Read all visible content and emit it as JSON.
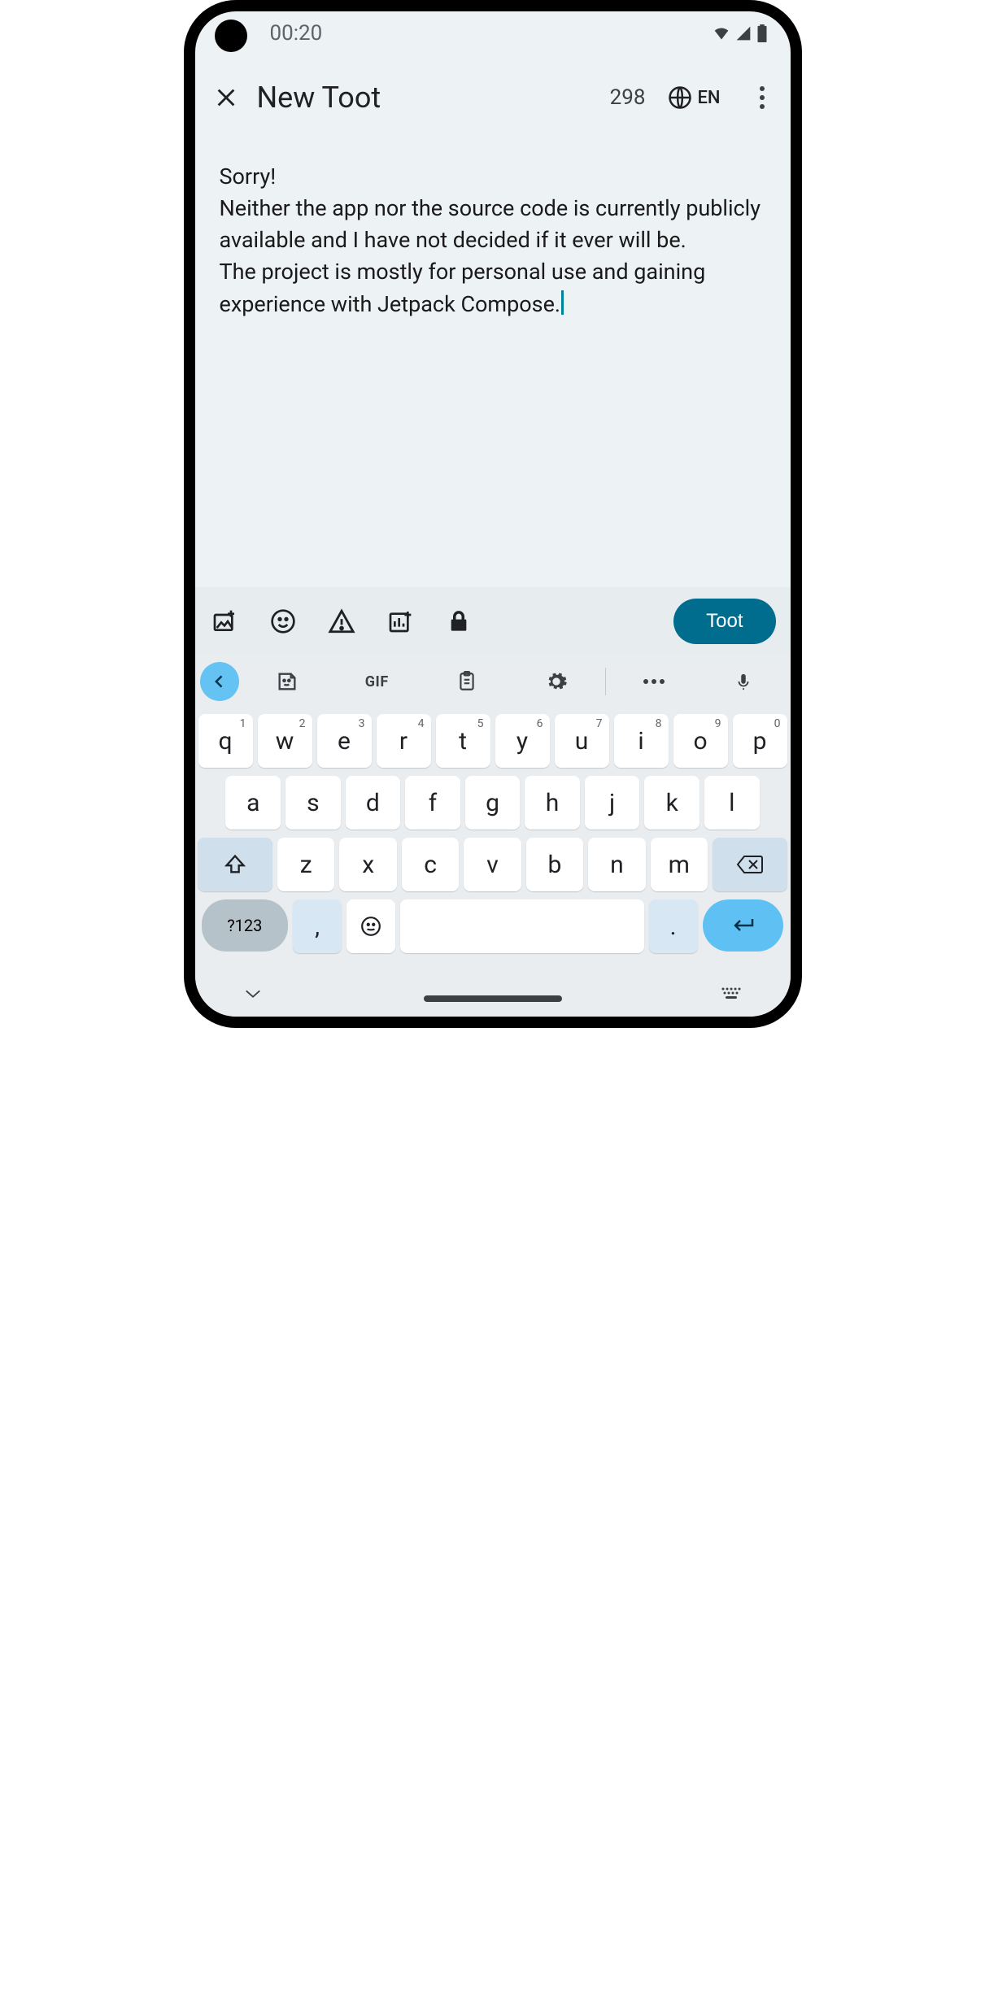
{
  "status": {
    "time": "00:20"
  },
  "appbar": {
    "title": "New Toot",
    "char_count": "298",
    "language": "EN"
  },
  "compose": {
    "text": "Sorry!\nNeither the app nor the source code is currently publicly available and I have not decided if it ever will be.\nThe project is mostly for personal use and gaining experience with Jetpack Compose."
  },
  "toolbar": {
    "submit_label": "Toot"
  },
  "keyboard": {
    "gif_label": "GIF",
    "row1": [
      {
        "k": "q",
        "s": "1"
      },
      {
        "k": "w",
        "s": "2"
      },
      {
        "k": "e",
        "s": "3"
      },
      {
        "k": "r",
        "s": "4"
      },
      {
        "k": "t",
        "s": "5"
      },
      {
        "k": "y",
        "s": "6"
      },
      {
        "k": "u",
        "s": "7"
      },
      {
        "k": "i",
        "s": "8"
      },
      {
        "k": "o",
        "s": "9"
      },
      {
        "k": "p",
        "s": "0"
      }
    ],
    "row2": [
      "a",
      "s",
      "d",
      "f",
      "g",
      "h",
      "j",
      "k",
      "l"
    ],
    "row3": [
      "z",
      "x",
      "c",
      "v",
      "b",
      "n",
      "m"
    ],
    "sym_label": "?123",
    "comma": ",",
    "period": "."
  }
}
